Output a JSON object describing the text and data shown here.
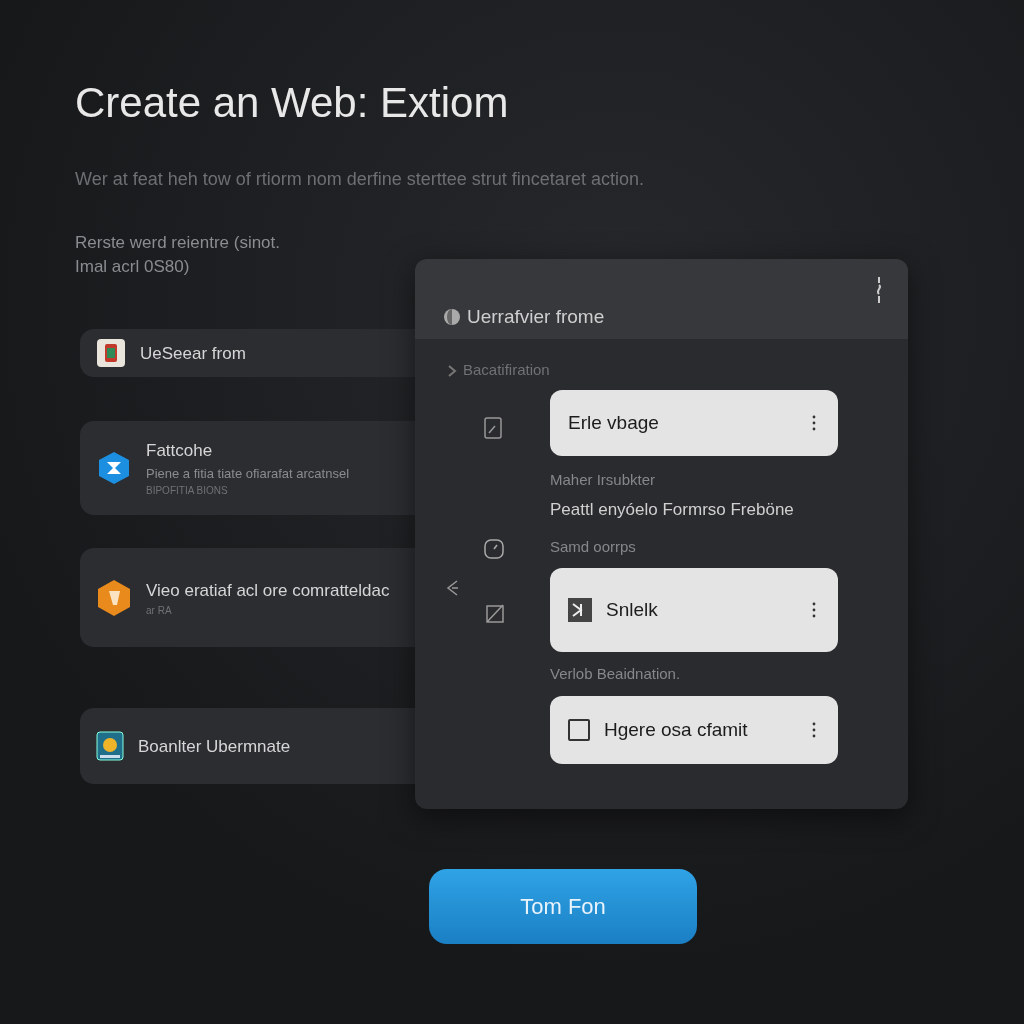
{
  "heading": {
    "title": "Create an Web: Extiom",
    "subtitle": "Wer at feat heh tow of rtiorm nom derfine sterttee strut fincetaret action.",
    "note": [
      "Rerste werd reientre (sinot.",
      "Imal acrl 0S80)"
    ]
  },
  "cards": [
    {
      "kind": "single",
      "title": "UeSeear from"
    },
    {
      "kind": "double",
      "title": "Fattcohe",
      "text": "Piene a fitia tiate ofiarafat arcatnsel",
      "caption": "BIPOFITIA BIONS"
    },
    {
      "kind": "double",
      "title": "Vieo eratiaf acl ore comratteldac",
      "caption": "ar RA"
    },
    {
      "kind": "single",
      "title": "Boanlter Ubermnate"
    }
  ],
  "panel": {
    "title": "Uerrafvier frome",
    "section": "Bacatifiration",
    "items": [
      {
        "kind": "plain",
        "label": "Erle vbage"
      },
      {
        "kind": "caption",
        "title": "Maher Irsubkter",
        "text": "Peattl enyóelo Formrso Freböne"
      },
      {
        "kind": "caption",
        "title": "Samd oorrps"
      },
      {
        "kind": "app",
        "label": "Snlelk"
      },
      {
        "kind": "caption",
        "title": "Verlob Beaidnation."
      },
      {
        "kind": "checkbox",
        "label": "Hgere osa cfamit",
        "checked": false
      }
    ]
  },
  "button": "Tom Fon"
}
